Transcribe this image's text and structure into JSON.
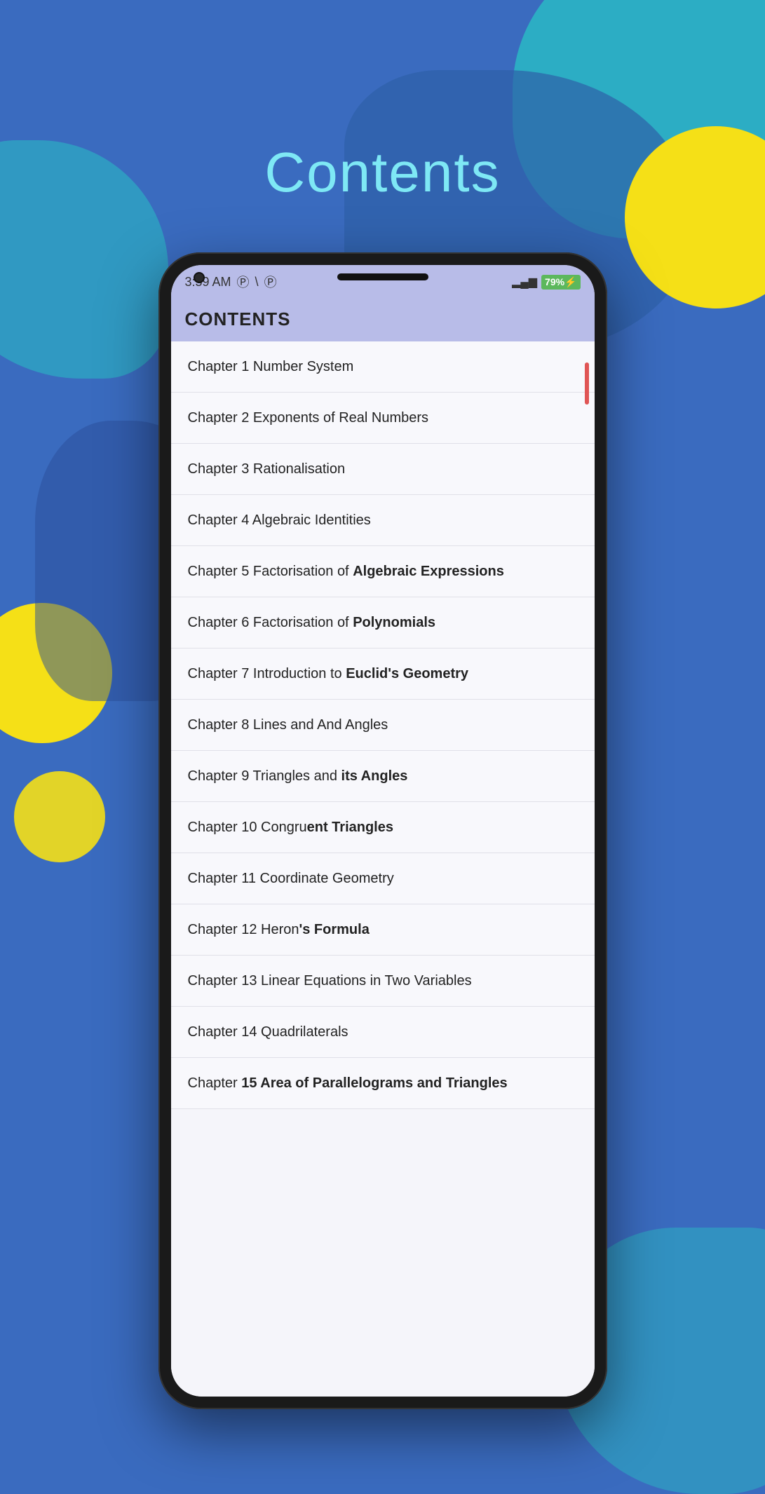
{
  "page": {
    "title": "Contents",
    "background_color": "#3a6bbf"
  },
  "status_bar": {
    "time": "3:59 AM",
    "icons": [
      "P",
      "\\",
      "P"
    ],
    "signal": "▂▄▆",
    "battery": "79",
    "charging": "⚡"
  },
  "header": {
    "title": "CONTENTS"
  },
  "chapters": [
    {
      "id": 1,
      "label": "Chapter 1 Number System",
      "bold_part": ""
    },
    {
      "id": 2,
      "label": "Chapter 2 Exponents of Real Numbers",
      "bold_part": ""
    },
    {
      "id": 3,
      "label": "Chapter 3 Rationalisation",
      "bold_part": ""
    },
    {
      "id": 4,
      "label": "Chapter 4 Algebraic Identities",
      "bold_part": ""
    },
    {
      "id": 5,
      "label": "Chapter 5 Factorisation of Algebraic Expressions",
      "bold_part": "Algebraic Expressions"
    },
    {
      "id": 6,
      "label": "Chapter 6 Factorisation of Polynomials",
      "bold_part": "Polynomials"
    },
    {
      "id": 7,
      "label": "Chapter 7 Introduction to Euclid's Geometry",
      "bold_part": "Euclid's Geometry"
    },
    {
      "id": 8,
      "label": "Chapter 8 Lines and And Angles",
      "bold_part": ""
    },
    {
      "id": 9,
      "label": "Chapter 9 Triangles and its Angles",
      "bold_part": "its Angles"
    },
    {
      "id": 10,
      "label": "Chapter 10 Congruent Triangles",
      "bold_part": "ent Triangles"
    },
    {
      "id": 11,
      "label": "Chapter 11 Coordinate Geometry",
      "bold_part": ""
    },
    {
      "id": 12,
      "label": "Chapter 12 Heron's Formula",
      "bold_part": "'s Formula"
    },
    {
      "id": 13,
      "label": "Chapter 13 Linear Equations in Two Variables",
      "bold_part": ""
    },
    {
      "id": 14,
      "label": "Chapter 14 Quadrilaterals",
      "bold_part": "Quadrilaterals"
    },
    {
      "id": 15,
      "label": "Chapter 15 Area of Parallelograms and Triangles",
      "bold_part": "15 Area of Parallelograms and Triangles"
    }
  ]
}
